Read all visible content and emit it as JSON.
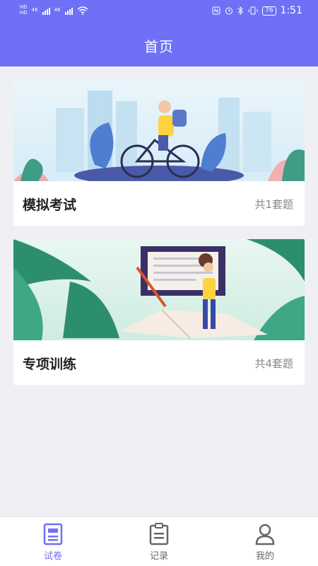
{
  "status_bar": {
    "left_labels": [
      "HD",
      "46",
      "46"
    ],
    "battery": "76",
    "time": "1:51"
  },
  "header": {
    "title": "首页"
  },
  "cards": [
    {
      "title": "模拟考试",
      "count": "共1套题"
    },
    {
      "title": "专项训练",
      "count": "共4套题"
    }
  ],
  "tabbar": {
    "items": [
      {
        "label": "试卷",
        "icon": "exam-paper-icon",
        "active": true
      },
      {
        "label": "记录",
        "icon": "record-clipboard-icon",
        "active": false
      },
      {
        "label": "我的",
        "icon": "user-profile-icon",
        "active": false
      }
    ]
  },
  "colors": {
    "primary": "#6f70f5",
    "background": "#eef0f3",
    "tab_inactive": "#666666"
  }
}
